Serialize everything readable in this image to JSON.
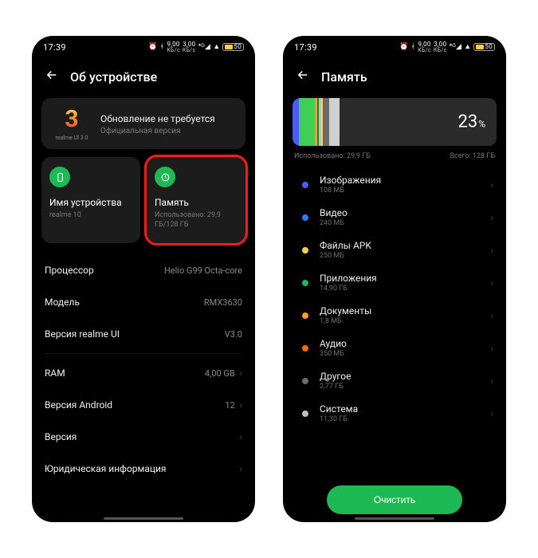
{
  "status": {
    "time": "17:39",
    "speed1_top": "9,00",
    "speed1_bot": "КБ/c",
    "speed2_top": "3,00",
    "speed2_bot": "КБ/c",
    "battery": "50"
  },
  "left": {
    "title": "Об устройстве",
    "banner": {
      "logo_num": "3",
      "logo_sub": "realme UI 3.0",
      "line1": "Обновление не требуется",
      "line2": "Официальная версия"
    },
    "card_device": {
      "label": "Имя устройства",
      "sub": "realme 10"
    },
    "card_storage": {
      "label": "Память",
      "sub": "Использовано: 29,9 ГБ/128 ГБ"
    },
    "rows": [
      {
        "key": "Процессор",
        "val": "Helio G99 Octa-core",
        "chev": false
      },
      {
        "key": "Модель",
        "val": "RMX3630",
        "chev": false
      },
      {
        "key": "Версия realme UI",
        "val": "V3.0",
        "chev": false
      },
      {
        "key": "RAM",
        "val": "4,00 GB",
        "chev": true
      },
      {
        "key": "Версия Android",
        "val": "12",
        "chev": true
      },
      {
        "key": "Версия",
        "val": "",
        "chev": true
      },
      {
        "key": "Юридическая информация",
        "val": "",
        "chev": true
      }
    ]
  },
  "right": {
    "title": "Память",
    "usage_pct": "23",
    "used_label": "Использовано: 29,9 ГБ",
    "total_label": "Всего: 128 ГБ",
    "segments": [
      {
        "color": "#4a5bff",
        "w": 3
      },
      {
        "color": "#3fcf57",
        "w": 8
      },
      {
        "color": "#ff9b2e",
        "w": 1
      },
      {
        "color": "#0a8f2f",
        "w": 1
      },
      {
        "color": "#c0c0c0",
        "w": 1
      },
      {
        "color": "#ffd24a",
        "w": 1
      },
      {
        "color": "#6a6a6a",
        "w": 3
      },
      {
        "color": "#d0d0d0",
        "w": 5
      }
    ],
    "items": [
      {
        "dot": "#4a5bff",
        "name": "Изображения",
        "size": "108 МБ"
      },
      {
        "dot": "#2e7bff",
        "name": "Видео",
        "size": "240 МБ"
      },
      {
        "dot": "#ffd24a",
        "name": "Файлы APK",
        "size": "250 МБ"
      },
      {
        "dot": "#1db954",
        "name": "Приложения",
        "size": "14,90  ГБ"
      },
      {
        "dot": "#ff9b2e",
        "name": "Документы",
        "size": "1,8 МБ"
      },
      {
        "dot": "#ff6a00",
        "name": "Аудио",
        "size": "350 МБ"
      },
      {
        "dot": "#6a6a6a",
        "name": "Другое",
        "size": "2,77 ГБ"
      },
      {
        "dot": "#c0c0c0",
        "name": "Система",
        "size": "11,30  ГБ"
      }
    ],
    "clean_btn": "Очистить"
  }
}
